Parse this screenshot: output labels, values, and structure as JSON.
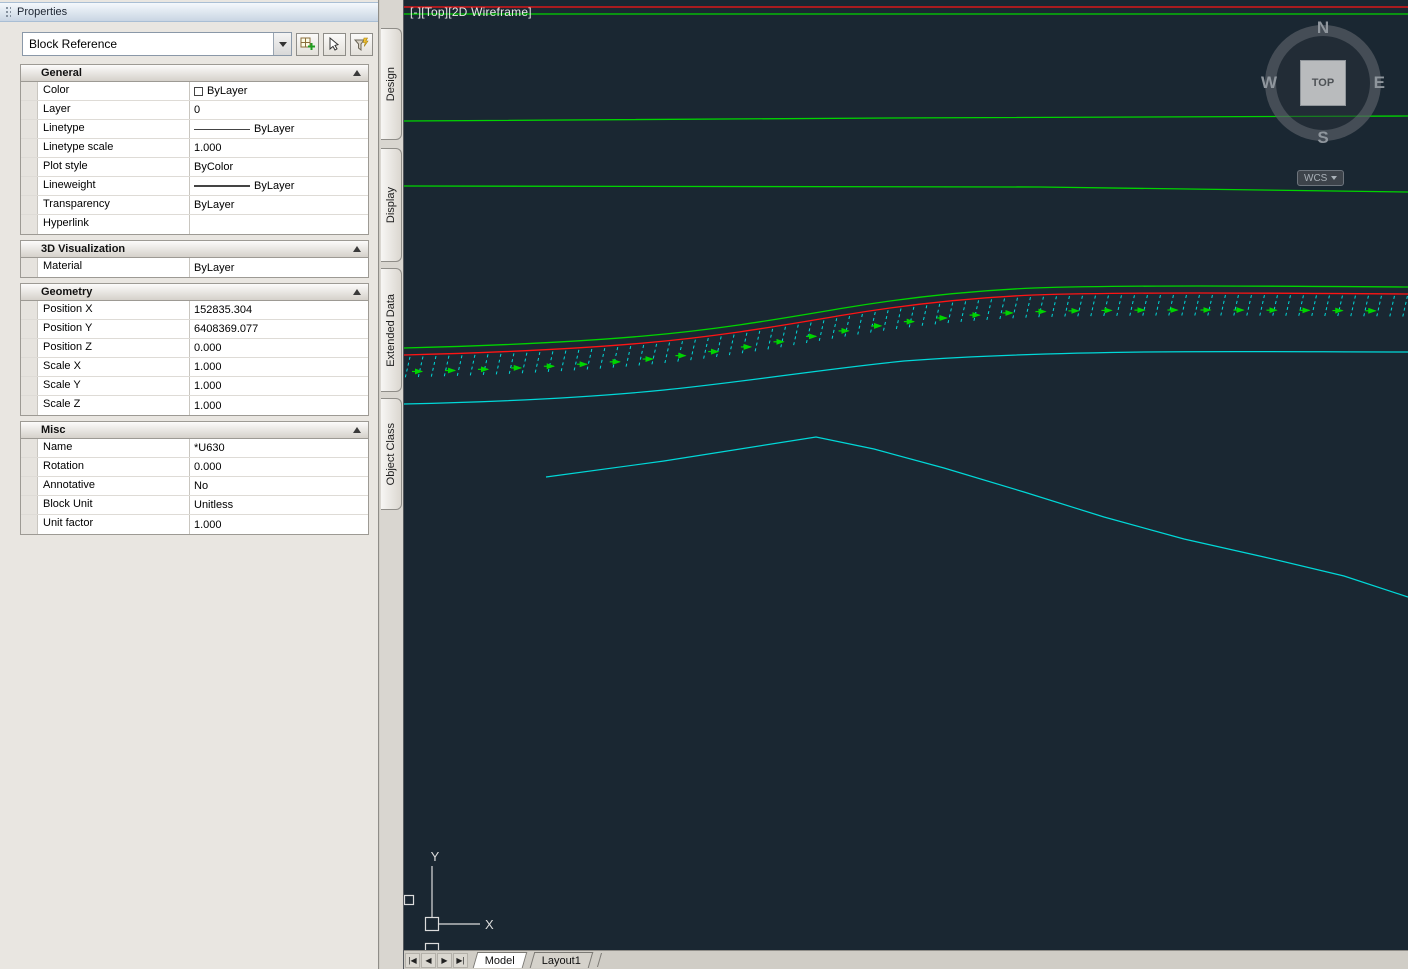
{
  "palette": {
    "title": "Properties",
    "type_selector": "Block Reference",
    "sections": [
      {
        "title": "General",
        "rows": [
          {
            "label": "Color",
            "value": "ByLayer"
          },
          {
            "label": "Layer",
            "value": "0"
          },
          {
            "label": "Linetype",
            "value": "ByLayer"
          },
          {
            "label": "Linetype scale",
            "value": "1.000"
          },
          {
            "label": "Plot style",
            "value": "ByColor"
          },
          {
            "label": "Lineweight",
            "value": "ByLayer"
          },
          {
            "label": "Transparency",
            "value": "ByLayer"
          },
          {
            "label": "Hyperlink",
            "value": ""
          }
        ]
      },
      {
        "title": "3D Visualization",
        "rows": [
          {
            "label": "Material",
            "value": "ByLayer"
          }
        ]
      },
      {
        "title": "Geometry",
        "rows": [
          {
            "label": "Position X",
            "value": "152835.304"
          },
          {
            "label": "Position Y",
            "value": "6408369.077"
          },
          {
            "label": "Position Z",
            "value": "0.000"
          },
          {
            "label": "Scale X",
            "value": "1.000"
          },
          {
            "label": "Scale Y",
            "value": "1.000"
          },
          {
            "label": "Scale Z",
            "value": "1.000"
          }
        ]
      },
      {
        "title": "Misc",
        "rows": [
          {
            "label": "Name",
            "value": "*U630"
          },
          {
            "label": "Rotation",
            "value": "0.000"
          },
          {
            "label": "Annotative",
            "value": "No"
          },
          {
            "label": "Block Unit",
            "value": "Unitless"
          },
          {
            "label": "Unit factor",
            "value": "1.000"
          }
        ]
      }
    ],
    "side_tabs": [
      "Design",
      "Display",
      "Extended Data",
      "Object Class"
    ]
  },
  "viewport": {
    "controls_label": "[-][Top][2D Wireframe]",
    "viewcube": {
      "north": "N",
      "south": "S",
      "west": "W",
      "east": "E",
      "face": "TOP",
      "wcs": "WCS"
    },
    "ucs_icon": {
      "x_label": "X",
      "y_label": "Y"
    },
    "colors": {
      "background": "#1a2732",
      "green": "#00d400",
      "red": "#ff1414",
      "cyan": "#00d8d8"
    }
  },
  "statusbar": {
    "nav_buttons": [
      "|◀",
      "◀",
      "▶",
      "▶|"
    ],
    "layout_tabs": [
      "Model",
      "Layout1"
    ]
  }
}
